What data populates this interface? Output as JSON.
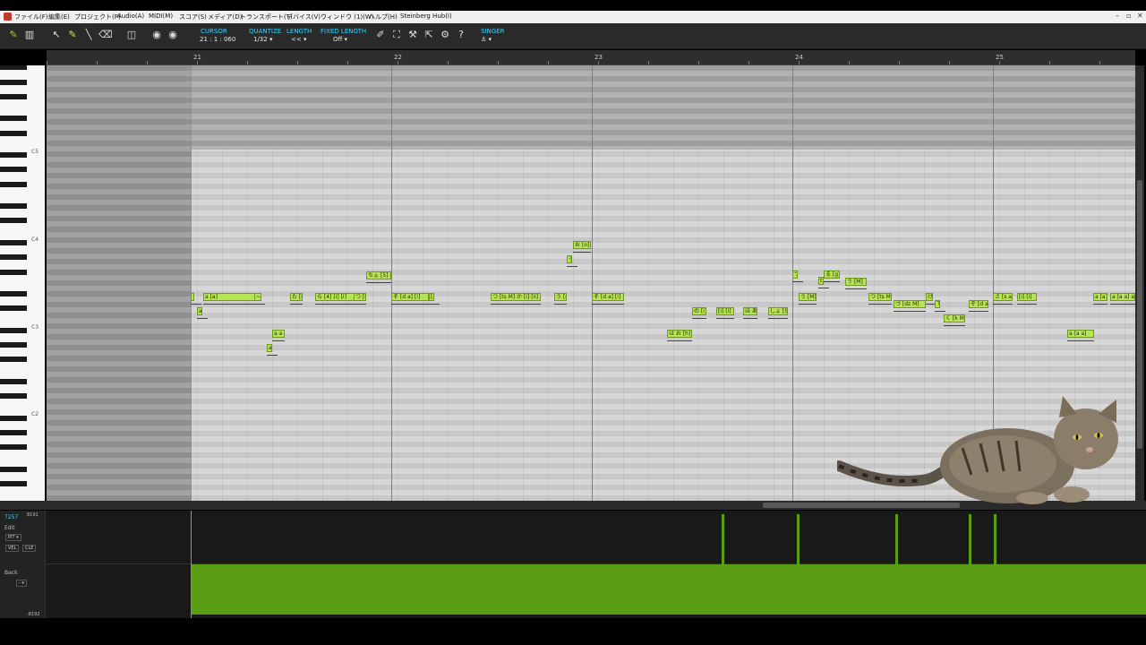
{
  "menubar": {
    "items": [
      "ファイル(F)",
      "編集(E)",
      "プロジェクト(P)",
      "Audio(A)",
      "MIDI(M)",
      "スコア(S)",
      "メディア(D)",
      "トランスポート(T)",
      "デバイス(V)",
      "ウィンドウ (1)(W)",
      "ヘルプ(H)",
      "Steinberg Hub(I)"
    ],
    "window_controls": [
      "–",
      "▫",
      "✕"
    ]
  },
  "toolbar": {
    "icons": [
      "logo-icon",
      "keyboard-icon",
      "pointer-icon",
      "pencil-icon",
      "line-icon",
      "eraser-icon",
      "split-icon",
      "vocal-icon-a",
      "vocal-icon-b"
    ],
    "cursor_label": "CURSOR",
    "cursor_value": "21 : 1 : 060",
    "quantize_label": "QUANTIZE",
    "quantize_value": "1/32 ▾",
    "length_label": "LENGTH",
    "length_value": "<< ▾",
    "fixed_length_label": "FIXED LENGTH",
    "fixed_length_value": "Off ▾",
    "singer_label": "SINGER",
    "singer_value": "♙ ▾",
    "right_icons": [
      "edit-icon",
      "fit-icon",
      "tool-icon",
      "export-icon",
      "settings-icon",
      "help-icon"
    ]
  },
  "ruler": {
    "bars": [
      "21",
      "22",
      "23",
      "24",
      "25"
    ]
  },
  "keyboard": {
    "labels": [
      "C5",
      "C4",
      "C3",
      "C2"
    ]
  },
  "notes": [
    {
      "text": "さ"
    },
    {
      "text": "a [a]"
    },
    {
      "text": "~[i]"
    },
    {
      "text": "a"
    },
    {
      "text": "a a"
    },
    {
      "text": "a"
    },
    {
      "text": "た [i]"
    },
    {
      "text": "ら [4] [i] [i]"
    },
    {
      "text": "つ [i]"
    },
    {
      "text": "ちょ [5] o"
    },
    {
      "text": "ぞ [d a] [i]"
    },
    {
      "text": "[a]"
    },
    {
      "text": "つ [ts M] か [i] [ii]"
    },
    {
      "text": "う [m]"
    },
    {
      "text": "ぞ [d a] [i]"
    },
    {
      "text": "お [o]"
    },
    {
      "text": "ろ"
    },
    {
      "text": "は お [h]"
    },
    {
      "text": "の [i]"
    },
    {
      "text": "[i] [i]"
    },
    {
      "text": "ほ あ"
    },
    {
      "text": "しょ [S]"
    },
    {
      "text": "つ"
    },
    {
      "text": "う [M]"
    },
    {
      "text": "t [ts]"
    },
    {
      "text": "る [g]"
    },
    {
      "text": "う [M]"
    },
    {
      "text": "つ [ts M]"
    },
    {
      "text": "づ [dz M]"
    },
    {
      "text": "け"
    },
    {
      "text": "て"
    },
    {
      "text": "く [k M]"
    },
    {
      "text": "ぞ [d a]"
    },
    {
      "text": "さ [s a]"
    },
    {
      "text": "[i] [i]"
    },
    {
      "text": "a [a]"
    },
    {
      "text": "a [a a]"
    },
    {
      "text": "a [a a] a"
    }
  ],
  "lower_panel": {
    "value_top": "7257",
    "range_top": "8191",
    "edit_label": "Edit",
    "param_select": "PIT ▾",
    "vel_button": "VEL",
    "cle_button": "CLE",
    "back_label": "Back",
    "back_select": "- ▾",
    "range_bottom": "-8192"
  }
}
